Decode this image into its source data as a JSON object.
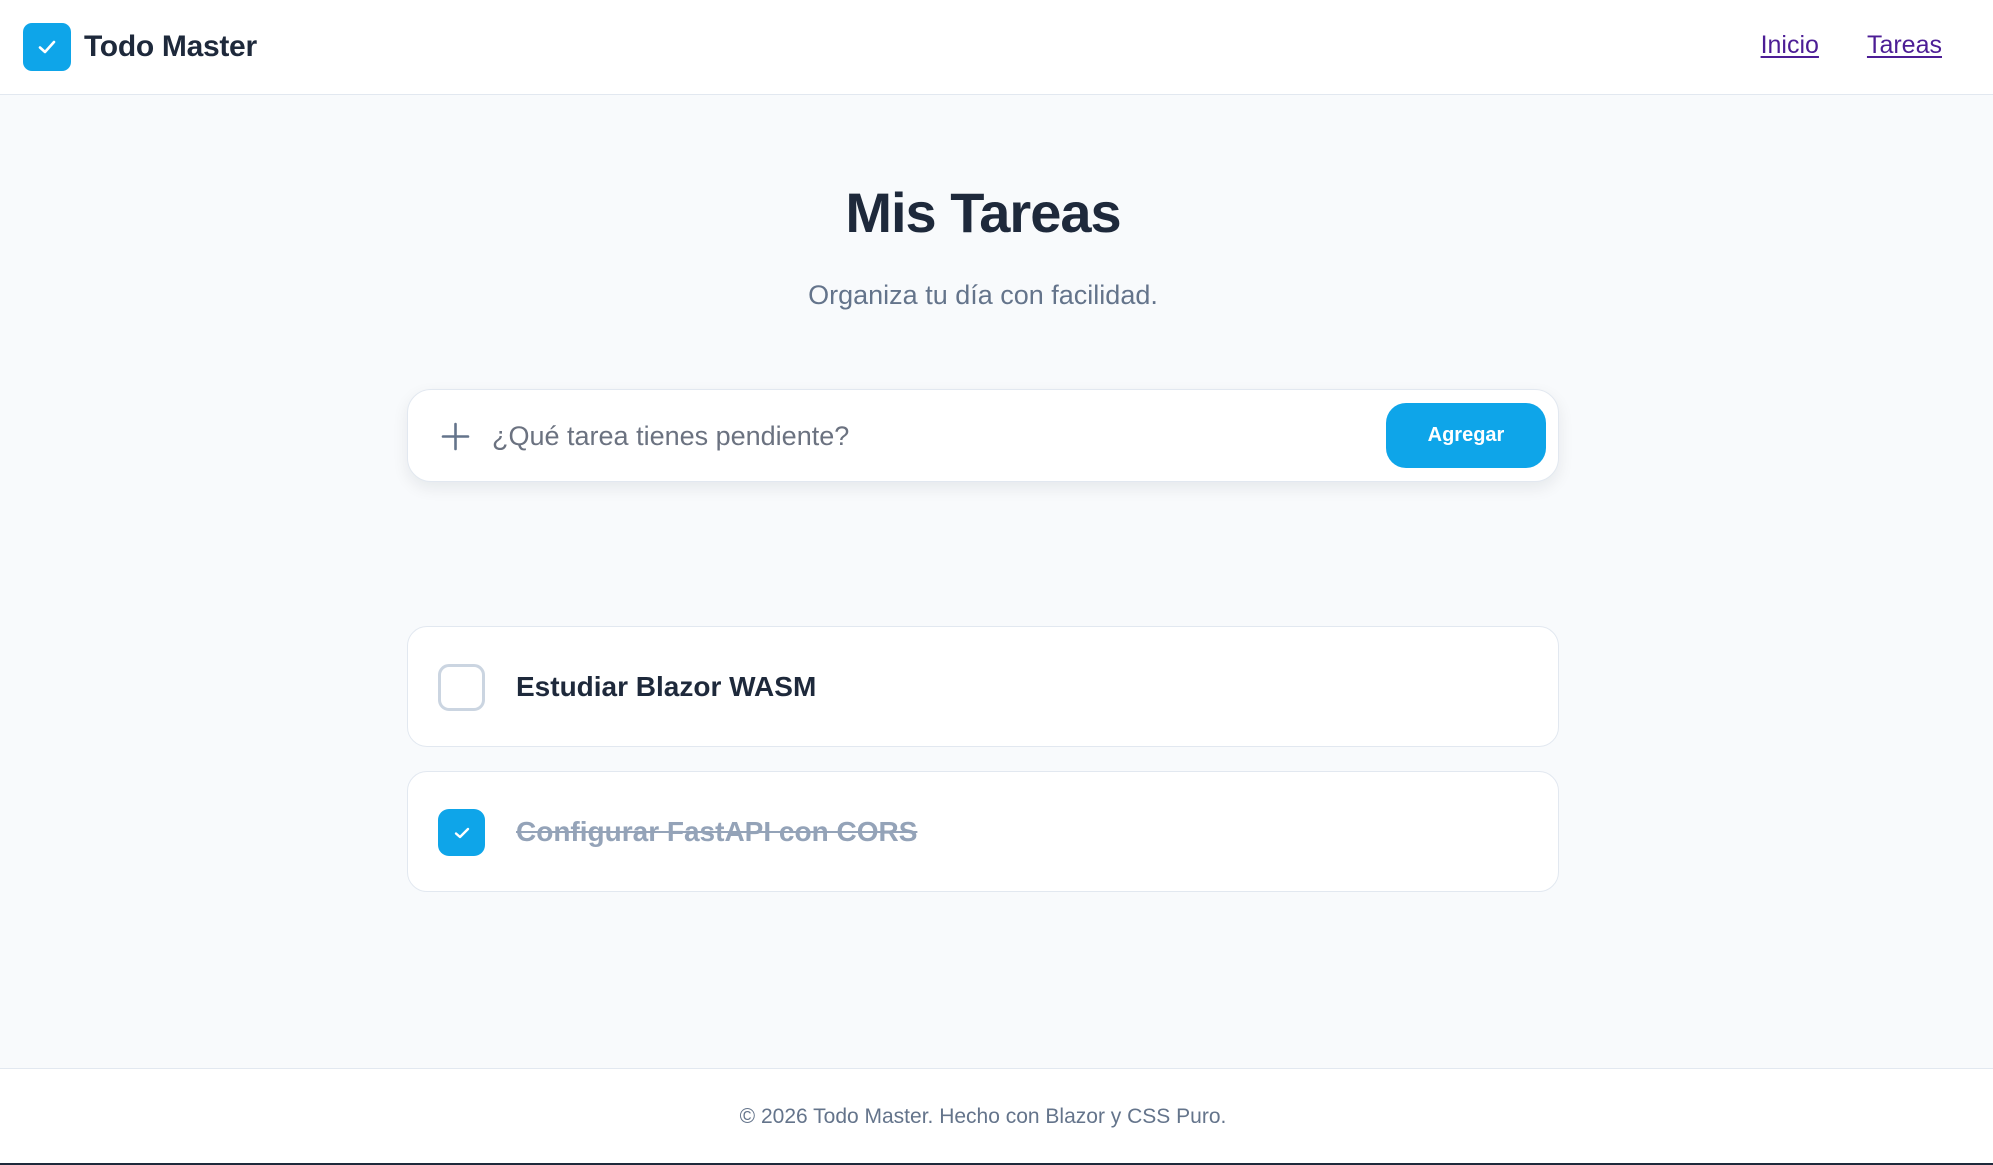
{
  "header": {
    "brand_name": "Todo Master",
    "nav": [
      {
        "label": "Inicio"
      },
      {
        "label": "Tareas"
      }
    ]
  },
  "main": {
    "title": "Mis Tareas",
    "subtitle": "Organiza tu día con facilidad.",
    "add_form": {
      "value": "",
      "placeholder": "¿Qué tarea tienes pendiente?",
      "button_label": "Agregar",
      "icon": "plus-icon"
    },
    "tasks": [
      {
        "text": "Estudiar Blazor WASM",
        "completed": false
      },
      {
        "text": "Configurar FastAPI con CORS",
        "completed": true
      }
    ]
  },
  "footer": {
    "text": "© 2026 Todo Master. Hecho con Blazor y CSS Puro."
  },
  "colors": {
    "accent": "#0ea5e9",
    "text_primary": "#1e293b",
    "text_muted": "#64748b",
    "link": "#4c1d95",
    "background": "#f8fafc"
  }
}
